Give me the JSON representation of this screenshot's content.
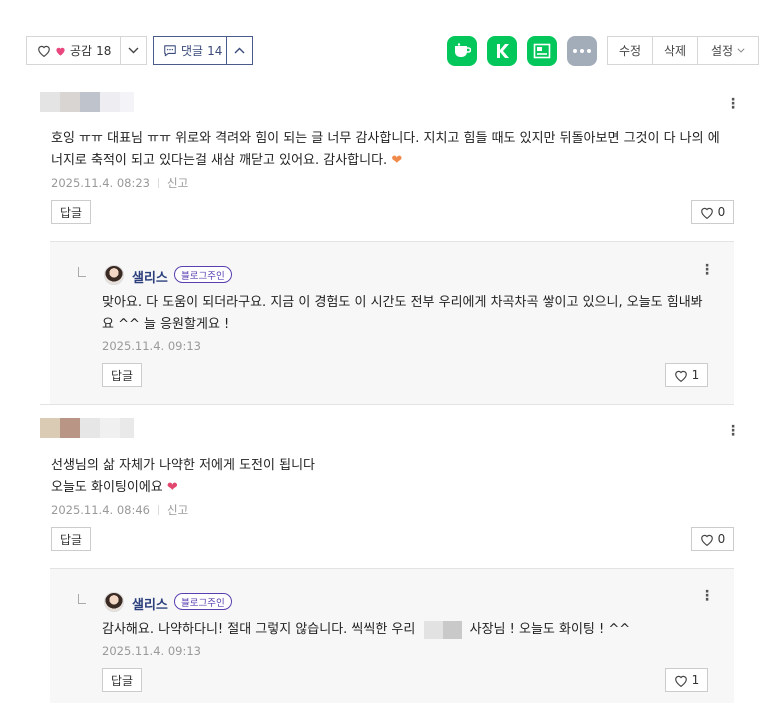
{
  "toolbar": {
    "like_label": "공감",
    "like_count": "18",
    "comment_label": "댓글",
    "comment_count": "14",
    "edit": "수정",
    "delete": "삭제",
    "settings": "설정"
  },
  "comments": [
    {
      "text1": "호잉 ㅠㅠ 대표님 ㅠㅠ 위로와 격려와 힘이 되는 글 너무 감사합니다. 지치고 힘들 때도 있지만 뒤돌아보면 그것이 다 나의 에",
      "text2": "너지로 축적이 되고 있다는걸 새삼 깨닫고 있어요. 감사합니다.",
      "date": "2025.11.4. 08:23",
      "report": "신고",
      "reply_label": "답글",
      "likes": "0"
    },
    {
      "text1": "선생님의 삶 자체가 나약한 저에게 도전이 됩니다",
      "text2": "오늘도 화이팅이에요",
      "date": "2025.11.4. 08:46",
      "report": "신고",
      "reply_label": "답글",
      "likes": "0"
    }
  ],
  "replies": [
    {
      "name": "샐리스",
      "badge": "블로그주인",
      "text1": "맞아요. 다 도움이 되더라구요. 지금 이 경험도 이 시간도 전부 우리에게 차곡차곡 쌓이고 있으니, 오늘도 힘내봐",
      "text2": "요 ^^ 늘 응원할게요 !",
      "date": "2025.11.4. 09:13",
      "reply_label": "답글",
      "likes": "1"
    },
    {
      "name": "샐리스",
      "badge": "블로그주인",
      "text_a": "감사해요. 나약하다니! 절대 그렇지 않습니다. 씩씩한 우리",
      "text_b": "사장님 ! 오늘도 화이팅 ! ^^",
      "date": "2025.11.4. 09:13",
      "reply_label": "답글",
      "likes": "1"
    }
  ],
  "colors": {
    "naver_green": "#03c75a",
    "accent_navy": "#2a3f7c",
    "badge_purple": "#5a3fb0"
  }
}
